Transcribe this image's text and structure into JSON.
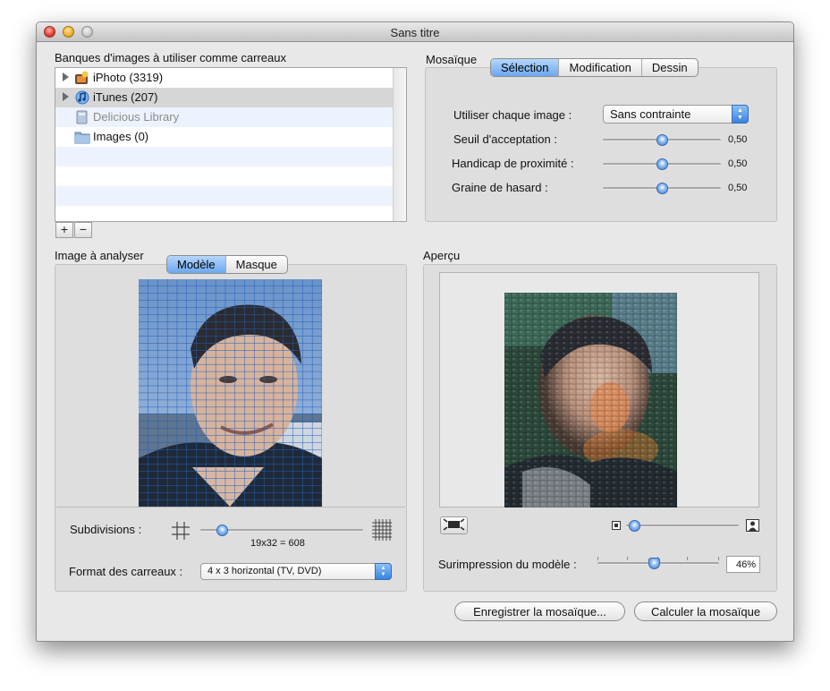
{
  "window": {
    "title": "Sans titre"
  },
  "sources": {
    "heading": "Banques d'images à utiliser comme carreaux",
    "items": [
      {
        "label": "iPhoto (3319)",
        "icon": "iphoto-icon",
        "enabled": true
      },
      {
        "label": "iTunes (207)",
        "icon": "itunes-icon",
        "enabled": true
      },
      {
        "label": "Delicious Library",
        "icon": "delicious-library-icon",
        "enabled": false
      },
      {
        "label": "Images (0)",
        "icon": "folder-icon",
        "enabled": true
      }
    ],
    "add_label": "+",
    "remove_label": "−"
  },
  "mosaic": {
    "heading": "Mosaïque",
    "tabs": [
      "Sélection",
      "Modification",
      "Dessin"
    ],
    "active_tab": "Sélection",
    "use_each_image_label": "Utiliser chaque image :",
    "use_each_image_value": "Sans contrainte",
    "threshold_label": "Seuil d'acceptation :",
    "threshold_value": "0,50",
    "proximity_label": "Handicap de proximité :",
    "proximity_value": "0,50",
    "seed_label": "Graine de hasard :",
    "seed_value": "0,50"
  },
  "analysis": {
    "heading": "Image à analyser",
    "tabs": [
      "Modèle",
      "Masque"
    ],
    "active_tab": "Modèle",
    "subdivisions_label": "Subdivisions :",
    "subdivisions_value": "19x32 = 608",
    "tile_format_label": "Format des carreaux :",
    "tile_format_value": "4 x 3 horizontal (TV, DVD)"
  },
  "preview": {
    "heading": "Aperçu",
    "overlay_label": "Surimpression du modèle :",
    "overlay_value": "46%"
  },
  "actions": {
    "save_label": "Enregistrer la mosaïque...",
    "compute_label": "Calculer la mosaïque"
  },
  "colors": {
    "accent": "#5b9de9",
    "grid": "#1f5fb8"
  }
}
